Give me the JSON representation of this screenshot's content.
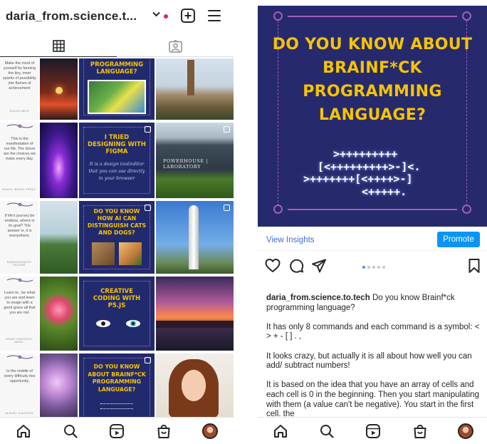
{
  "left": {
    "username": "daria_from.science.t...",
    "grid": {
      "quotes": [
        {
          "text": "Make the most of yourself by fanning the tiny, inner sparks of possibility into flames of achievement",
          "author": "GOLDA MEIR"
        },
        {
          "text": "This is the manifestation of our life. The doors are the choices we make every day.",
          "author": "SOKKA \"BEING FRIDA\""
        },
        {
          "text": "If life's journey be endless, where is its goal? The answer is, it is everywhere.",
          "author": "RABINDRANATH TAGORE"
        },
        {
          "text": "Learn to.. be what you are and learn to resign with a good grace all that you are not.",
          "author": "HENRI-FREDERIC AMIEL"
        },
        {
          "text": "In the middle of every difficulty lies opportunity.",
          "author": "ALBERT EINSTEIN"
        }
      ],
      "tiles": {
        "programming_title": "PROGRAMMING LANGUAGE?",
        "figma_title": "I TRIED DESIGNING WITH FIGMA",
        "figma_sub": "It is a design tool/editor that you can use directly in your browser",
        "cats_dogs_title": "DO YOU KNOW HOW AI CAN DISTINGUISH CATS AND DOGS?",
        "p5_title": "CREATIVE CODING WITH P5.JS",
        "bf_title": "DO YOU KNOW ABOUT BRAINF*CK PROGRAMMING LANGUAGE?",
        "lab_caption": "POWERHOUSE | LABORATORY"
      }
    }
  },
  "right": {
    "post_title": "DO YOU KNOW ABOUT BRAINF*CK PROGRAMMING LANGUAGE?",
    "code_lines": [
      ">+++++++++",
      "[<+++++++++>-]<.",
      ">+++++++[<++++>-]",
      "<+++++."
    ],
    "view_insights": "View Insights",
    "promote": "Promote",
    "caption_user": "daria_from.science.to.tech",
    "caption_first": "Do you know Brainf*ck programming language?",
    "caption_paragraphs": [
      "It has only 8 commands and each command is a symbol: < > + - [ ] . ,",
      "It looks crazy, but actually it is all about how well you can add/ subtract numbers!",
      "It is based on the idea that you have an array of cells and each cell is 0 in the beginning. Then you start manipulating with them (a value can't be negative). You start in the first cell, the"
    ],
    "carousel": {
      "count": 5,
      "active": 1
    }
  },
  "colors": {
    "tile_bg": "#222a6e",
    "tile_yellow": "#f5c400",
    "tile_purple": "#a05fb7",
    "promote_blue": "#0a95f6",
    "link_blue": "#3b6fd6"
  },
  "icons": {
    "left_header": [
      "chevron-down-icon",
      "add-post-icon",
      "hamburger-menu-icon"
    ],
    "tabs": [
      "grid-icon",
      "tagged-icon"
    ],
    "nav": [
      "home-icon",
      "search-icon",
      "reels-icon",
      "shop-icon",
      "profile-avatar"
    ],
    "post_actions": [
      "heart-icon",
      "comment-icon",
      "share-icon",
      "bookmark-icon"
    ]
  }
}
